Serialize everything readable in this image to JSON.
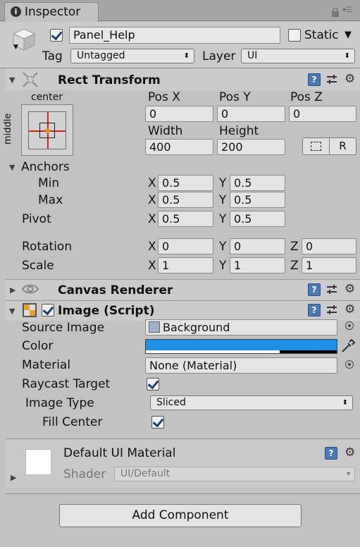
{
  "tab": {
    "title": "Inspector"
  },
  "object": {
    "name": "Panel_Help",
    "active": true,
    "static_label": "Static",
    "tag_label": "Tag",
    "tag_value": "Untagged",
    "layer_label": "Layer",
    "layer_value": "UI"
  },
  "rect_transform": {
    "title": "Rect Transform",
    "anchor_h": "center",
    "anchor_v": "middle",
    "pos_x_label": "Pos X",
    "pos_y_label": "Pos Y",
    "pos_z_label": "Pos Z",
    "pos_x": "0",
    "pos_y": "0",
    "pos_z": "0",
    "width_label": "Width",
    "height_label": "Height",
    "width": "400",
    "height": "200",
    "raw_button": "R",
    "anchors_label": "Anchors",
    "min_label": "Min",
    "max_label": "Max",
    "min_x": "0.5",
    "min_y": "0.5",
    "max_x": "0.5",
    "max_y": "0.5",
    "pivot_label": "Pivot",
    "pivot_x": "0.5",
    "pivot_y": "0.5",
    "rotation_label": "Rotation",
    "rot_x": "0",
    "rot_y": "0",
    "rot_z": "0",
    "scale_label": "Scale",
    "scale_x": "1",
    "scale_y": "1",
    "scale_z": "1",
    "x": "X",
    "y": "Y",
    "z": "Z"
  },
  "canvas_renderer": {
    "title": "Canvas Renderer"
  },
  "image": {
    "title": "Image (Script)",
    "enabled": true,
    "source_label": "Source Image",
    "source_value": "Background",
    "color_label": "Color",
    "color_hex": "#1e90e8",
    "color_alpha": 0.7,
    "material_label": "Material",
    "material_value": "None (Material)",
    "raycast_label": "Raycast Target",
    "raycast": true,
    "type_label": "Image Type",
    "type_value": "Sliced",
    "fill_label": "Fill Center",
    "fill": true
  },
  "material_asset": {
    "title": "Default UI Material",
    "shader_label": "Shader",
    "shader_value": "UI/Default"
  },
  "add_component": {
    "label": "Add Component"
  }
}
